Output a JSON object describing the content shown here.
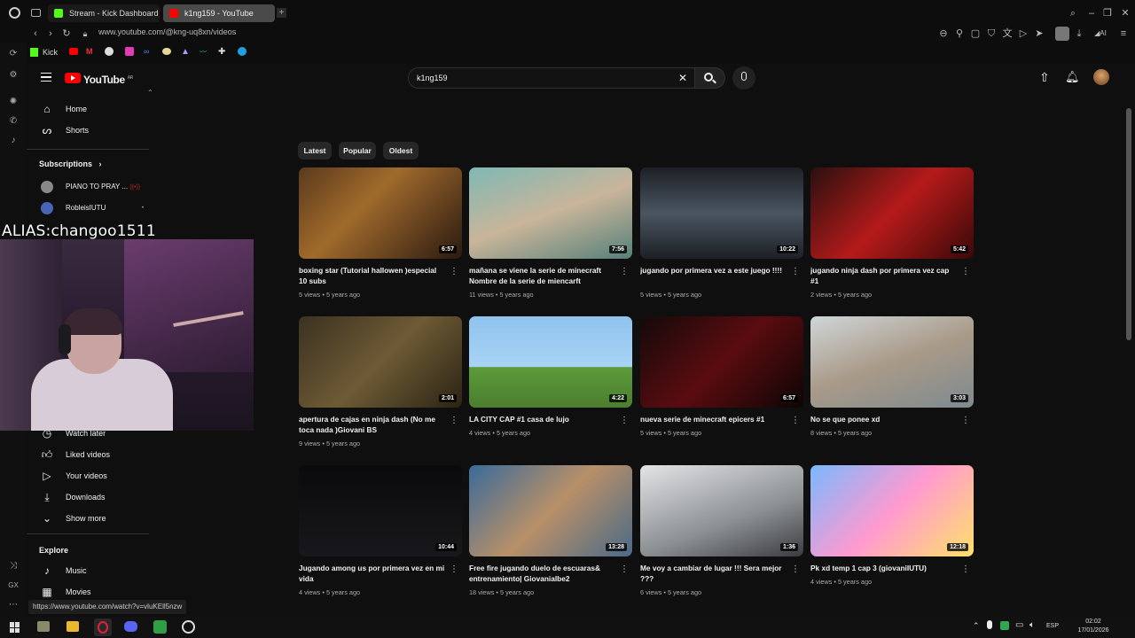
{
  "browser": {
    "tabs": [
      {
        "label": "Stream - Kick Dashboard",
        "color": "#53fc18"
      },
      {
        "label": "k1ng159 - YouTube",
        "color": "#ff0000"
      }
    ],
    "url": "www.youtube.com/@kng-uq8xn/videos",
    "bookmark_label": "Kick",
    "status_url": "https://www.youtube.com/watch?v=vluKEll5nzw"
  },
  "youtube": {
    "logo_text": "YouTube",
    "logo_region": "AR",
    "search_value": "k1ng159",
    "sidebar": {
      "home": "Home",
      "shorts": "Shorts",
      "subscriptions": "Subscriptions",
      "subs": [
        {
          "label": "PIANO TO PRAY ..."
        },
        {
          "label": "RobleisIUTU"
        }
      ],
      "watch_later": "Watch later",
      "liked": "Liked videos",
      "your_videos": "Your videos",
      "downloads": "Downloads",
      "show_more": "Show more",
      "explore": "Explore",
      "music": "Music",
      "movies": "Movies"
    },
    "chips": [
      "Latest",
      "Popular",
      "Oldest"
    ],
    "videos": [
      {
        "title": "boxing star (Tutorial hallowen )especial 10 subs",
        "meta": "5 views • 5 years ago",
        "duration": "6:57"
      },
      {
        "title": "mañana se viene la serie de minecraft Nombre de la serie de miencarft (epicers)...",
        "meta": "11 views • 5 years ago",
        "duration": "7:56"
      },
      {
        "title": "jugando por primera vez a este juego !!!!",
        "meta": "5 views • 5 years ago",
        "duration": "10:22"
      },
      {
        "title": "jugando ninja dash por primera vez cap #1",
        "meta": "2 views • 5 years ago",
        "duration": "5:42"
      },
      {
        "title": "apertura de cajas en ninja dash (No me toca nada )Giovani BS",
        "meta": "9 views • 5 years ago",
        "duration": "2:01"
      },
      {
        "title": "LA CITY CAP #1 casa de lujo",
        "meta": "4 views • 5 years ago",
        "duration": "4:22"
      },
      {
        "title": "nueva serie de minecraft epicers #1",
        "meta": "5 views • 5 years ago",
        "duration": "6:57"
      },
      {
        "title": "No se que ponee xd",
        "meta": "8 views • 5 years ago",
        "duration": "3:03"
      },
      {
        "title": "Jugando among us por primera vez en mi vida",
        "meta": "4 views • 5 years ago",
        "duration": "10:44"
      },
      {
        "title": "Free fire jugando duelo de escuaras& entrenamiento| Giovanialbe2",
        "meta": "18 views • 5 years ago",
        "duration": "13:28"
      },
      {
        "title": "Me voy a cambiar de lugar !!! Sera mejor ???",
        "meta": "6 views • 5 years ago",
        "duration": "1:36"
      },
      {
        "title": "Pk xd temp 1 cap 3 (giovaniIUTU)",
        "meta": "4 views • 5 years ago",
        "duration": "12:18"
      }
    ]
  },
  "overlay": {
    "alias": "ALIAS:changoo1511"
  },
  "taskbar": {
    "lang": "ESP",
    "time": "02:02",
    "date": "17/01/2026"
  }
}
